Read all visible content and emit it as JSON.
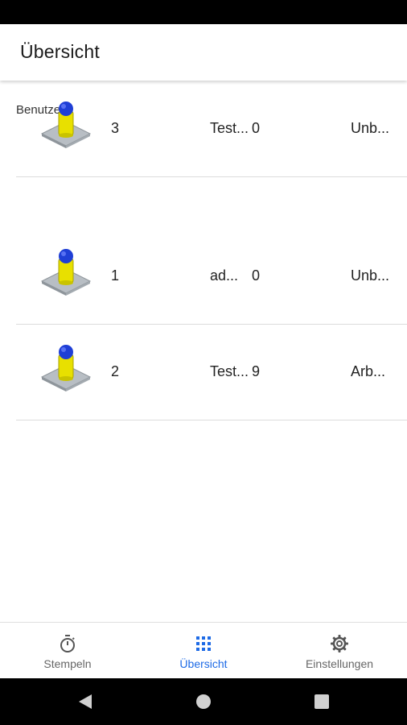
{
  "app_bar": {
    "title": "Übersicht"
  },
  "section": {
    "label": "Benutzer"
  },
  "users": [
    {
      "id": "1",
      "name": "ad...",
      "count": "0",
      "status": "Unb..."
    },
    {
      "id": "2",
      "name": "Test...",
      "count": "9",
      "status": "Arb..."
    },
    {
      "id": "3",
      "name": "Test...",
      "count": "0",
      "status": "Unb..."
    }
  ],
  "bottom_nav": {
    "items": [
      {
        "label": "Stempeln",
        "icon": "stopwatch-icon",
        "active": false
      },
      {
        "label": "Übersicht",
        "icon": "grid-icon",
        "active": true
      },
      {
        "label": "Einstellungen",
        "icon": "gear-icon",
        "active": false
      }
    ]
  },
  "colors": {
    "accent": "#1e6be6",
    "pin_head": "#1f3fd6",
    "pin_body": "#e8e000",
    "base": "#b8bec4"
  }
}
